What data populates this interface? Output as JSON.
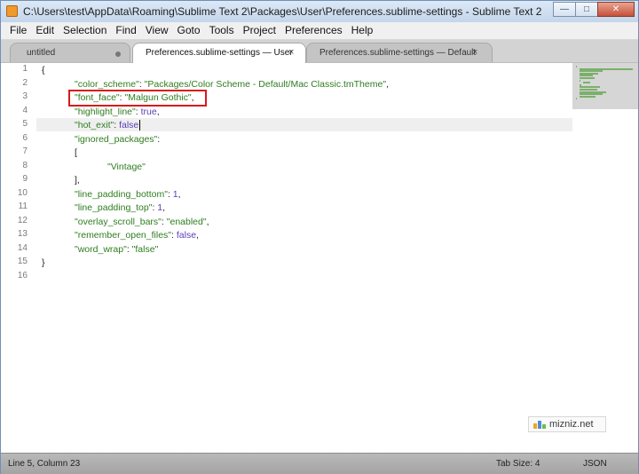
{
  "window": {
    "title": "C:\\Users\\test\\AppData\\Roaming\\Sublime Text 2\\Packages\\User\\Preferences.sublime-settings - Sublime Text 2",
    "minimize_glyph": "—",
    "maximize_glyph": "□",
    "close_glyph": "✕"
  },
  "menu": [
    "File",
    "Edit",
    "Selection",
    "Find",
    "View",
    "Goto",
    "Tools",
    "Project",
    "Preferences",
    "Help"
  ],
  "tabs": [
    {
      "label": "untitled",
      "modified": true
    },
    {
      "label": "Preferences.sublime-settings — User",
      "close": "×",
      "active": true
    },
    {
      "label": "Preferences.sublime-settings — Default",
      "close": "×"
    }
  ],
  "editor": {
    "line_numbers": [
      "1",
      "2",
      "3",
      "4",
      "5",
      "6",
      "7",
      "8",
      "9",
      "10",
      "11",
      "12",
      "13",
      "14",
      "15",
      "16"
    ],
    "lines": [
      [
        {
          "t": "{",
          "c": "punc"
        }
      ],
      [
        {
          "t": "\"color_scheme\"",
          "c": "str"
        },
        {
          "t": ": ",
          "c": "punc"
        },
        {
          "t": "\"Packages/Color Scheme - Default/Mac Classic.tmTheme\"",
          "c": "str"
        },
        {
          "t": ",",
          "c": "punc"
        }
      ],
      [
        {
          "t": "\"font_face\"",
          "c": "str"
        },
        {
          "t": ": ",
          "c": "punc"
        },
        {
          "t": "\"Malgun Gothic\"",
          "c": "str"
        },
        {
          "t": ",",
          "c": "punc"
        }
      ],
      [
        {
          "t": "\"highlight_line\"",
          "c": "str"
        },
        {
          "t": ": ",
          "c": "punc"
        },
        {
          "t": "true",
          "c": "kw"
        },
        {
          "t": ",",
          "c": "punc"
        }
      ],
      [
        {
          "t": "\"hot_exit\"",
          "c": "str"
        },
        {
          "t": ": ",
          "c": "punc"
        },
        {
          "t": "false",
          "c": "kw"
        }
      ],
      [
        {
          "t": "\"ignored_packages\"",
          "c": "str"
        },
        {
          "t": ":",
          "c": "punc"
        }
      ],
      [
        {
          "t": "[",
          "c": "punc"
        }
      ],
      [
        {
          "t": "\"Vintage\"",
          "c": "str"
        }
      ],
      [
        {
          "t": "],",
          "c": "punc"
        }
      ],
      [
        {
          "t": "\"line_padding_bottom\"",
          "c": "str"
        },
        {
          "t": ": ",
          "c": "punc"
        },
        {
          "t": "1",
          "c": "num"
        },
        {
          "t": ",",
          "c": "punc"
        }
      ],
      [
        {
          "t": "\"line_padding_top\"",
          "c": "str"
        },
        {
          "t": ": ",
          "c": "punc"
        },
        {
          "t": "1",
          "c": "num"
        },
        {
          "t": ",",
          "c": "punc"
        }
      ],
      [
        {
          "t": "\"overlay_scroll_bars\"",
          "c": "str"
        },
        {
          "t": ": ",
          "c": "punc"
        },
        {
          "t": "\"enabled\"",
          "c": "str"
        },
        {
          "t": ",",
          "c": "punc"
        }
      ],
      [
        {
          "t": "\"remember_open_files\"",
          "c": "str"
        },
        {
          "t": ": ",
          "c": "punc"
        },
        {
          "t": "false",
          "c": "kw"
        },
        {
          "t": ",",
          "c": "punc"
        }
      ],
      [
        {
          "t": "\"word_wrap\"",
          "c": "str"
        },
        {
          "t": ": ",
          "c": "punc"
        },
        {
          "t": "\"false\"",
          "c": "str"
        }
      ],
      [
        {
          "t": "}",
          "c": "punc"
        }
      ],
      []
    ],
    "indent_levels": [
      0,
      1,
      1,
      1,
      1,
      1,
      1,
      2,
      1,
      1,
      1,
      1,
      1,
      1,
      0,
      0
    ],
    "cursor_line": 5,
    "colors": {
      "string": "#2e7d1f",
      "constant": "#5b3fb8",
      "highlight_box": "#d8191c"
    }
  },
  "watermark": {
    "text": "mizniz.net"
  },
  "status": {
    "position": "Line 5, Column 23",
    "tab_size": "Tab Size: 4",
    "syntax": "JSON"
  }
}
